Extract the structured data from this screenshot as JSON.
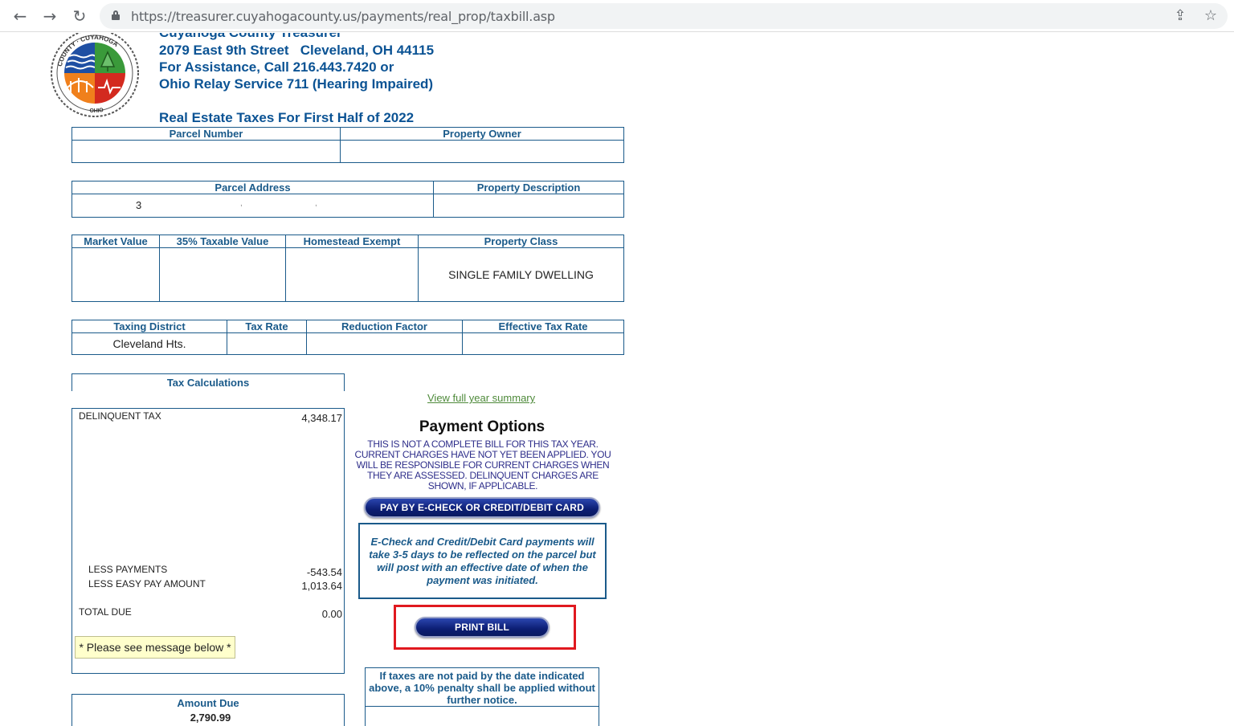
{
  "browser": {
    "url": "https://treasurer.cuyahogacounty.us/payments/real_prop/taxbill.asp",
    "back_glyph": "←",
    "forward_glyph": "→",
    "reload_glyph": "↻",
    "share_glyph": "⇪",
    "star_glyph": "☆"
  },
  "header": {
    "title": "Cuyahoga County Treasurer",
    "address": "2079 East 9th Street   Cleveland, OH 44115",
    "assistance": "For Assistance, Call 216.443.7420 or",
    "relay": "Ohio Relay Service 711 (Hearing Impaired)",
    "subtitle": "Real Estate Taxes For First Half of 2022"
  },
  "logo": {
    "top_text": "COUNTY · CUYAHOGA",
    "bottom_text": "OHIO",
    "colors": {
      "water": "#1f4fa3",
      "tree": "#3a9a3a",
      "bridge": "#f0801c",
      "heart": "#d32a1f"
    }
  },
  "parcel": {
    "number_label": "Parcel Number",
    "owner_label": "Property Owner",
    "number": "",
    "owner": ""
  },
  "address_block": {
    "address_label": "Parcel Address",
    "description_label": "Property Description",
    "address": "3",
    "address_sep1": ",",
    "address_sep2": ",",
    "description": ""
  },
  "valuation": {
    "market_label": "Market Value",
    "taxable_label": "35% Taxable Value",
    "homestead_label": "Homestead Exempt",
    "class_label": "Property Class",
    "market": "",
    "taxable": "",
    "homestead": "",
    "class": "SINGLE FAMILY DWELLING"
  },
  "district": {
    "district_label": "Taxing District",
    "rate_label": "Tax Rate",
    "reduction_label": "Reduction Factor",
    "effective_label": "Effective Tax Rate",
    "district": "Cleveland Hts.",
    "rate": "",
    "reduction": "",
    "effective": ""
  },
  "tax_calc": {
    "heading": "Tax Calculations",
    "delinquent_label": "DELINQUENT TAX",
    "delinquent_value": "4,348.17",
    "less_payments_label": "LESS PAYMENTS",
    "less_payments_value": "-543.54",
    "less_easy_label": "LESS EASY PAY AMOUNT",
    "less_easy_value": "1,013.64",
    "total_label": "TOTAL DUE",
    "total_value": "0.00",
    "note": "* Please see message below *"
  },
  "amount_due": {
    "label": "Amount Due",
    "value": "2,790.99"
  },
  "payment": {
    "view_link": "View full year summary",
    "title": "Payment Options",
    "notice": "THIS IS NOT A COMPLETE BILL FOR THIS TAX YEAR. CURRENT CHARGES HAVE NOT YET BEEN APPLIED. YOU WILL BE RESPONSIBLE FOR CURRENT CHARGES WHEN THEY ARE ASSESSED. DELINQUENT CHARGES ARE SHOWN, IF APPLICABLE.",
    "pay_button": "PAY BY E-CHECK OR CREDIT/DEBIT CARD",
    "echeck_note": "E-Check and Credit/Debit Card payments will take 3-5 days to be reflected on the parcel but will post with an effective date of when the payment was initiated.",
    "print_button": "PRINT BILL",
    "highlight_color": "#e0191f",
    "penalty_note": "If taxes are not paid by the date indicated above, a 10% penalty shall be applied without further notice."
  }
}
